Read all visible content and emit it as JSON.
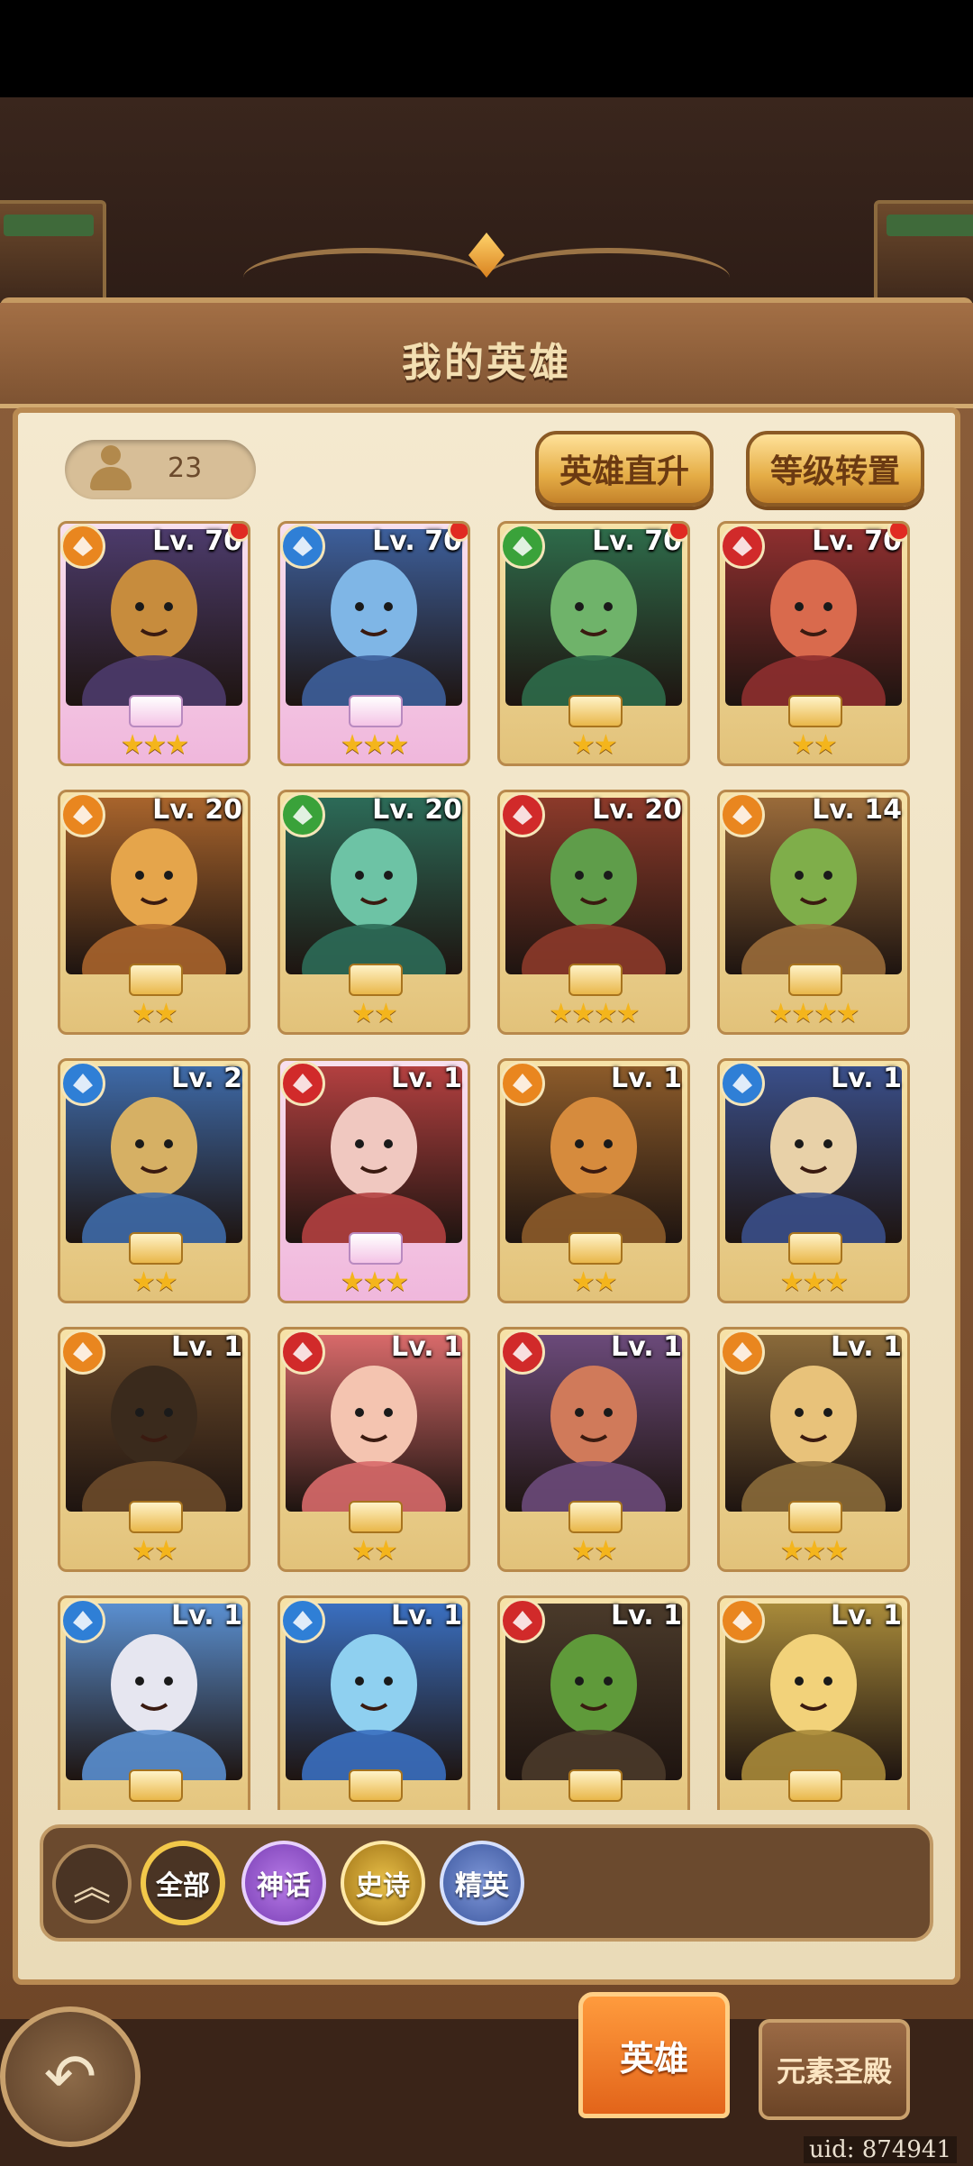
{
  "header": {
    "title": "我的英雄"
  },
  "hero_count": "23",
  "buttons": {
    "hero_boost": "英雄直升",
    "level_transfer": "等级转置"
  },
  "elements": {
    "fire": "#e9861f",
    "water": "#2f7fd6",
    "nature": "#3aa23a",
    "red": "#d12a2a"
  },
  "heroes": [
    {
      "level": "Lv. 70",
      "element": "fire",
      "stars": "★★★",
      "rarity": "mythic",
      "red_dot": true,
      "portrait": "dragonborn-warlock"
    },
    {
      "level": "Lv. 70",
      "element": "water",
      "stars": "★★★",
      "rarity": "mythic",
      "red_dot": true,
      "portrait": "blue-haired-fighter"
    },
    {
      "level": "Lv. 70",
      "element": "nature",
      "stars": "★★",
      "rarity": "epic",
      "red_dot": true,
      "portrait": "green-orc-druid"
    },
    {
      "level": "Lv. 70",
      "element": "red",
      "stars": "★★",
      "rarity": "epic",
      "red_dot": true,
      "portrait": "red-haired-bandit"
    },
    {
      "level": "Lv. 20",
      "element": "fire",
      "stars": "★★",
      "rarity": "epic",
      "red_dot": false,
      "portrait": "jester"
    },
    {
      "level": "Lv. 20",
      "element": "nature",
      "stars": "★★",
      "rarity": "epic",
      "red_dot": false,
      "portrait": "green-haired-elf"
    },
    {
      "level": "Lv. 20",
      "element": "red",
      "stars": "★★★★",
      "rarity": "elite",
      "red_dot": false,
      "portrait": "orc-pirate"
    },
    {
      "level": "Lv. 14",
      "element": "fire",
      "stars": "★★★★",
      "rarity": "elite",
      "red_dot": false,
      "portrait": "goblin-girl"
    },
    {
      "level": "Lv. 2",
      "element": "water",
      "stars": "★★",
      "rarity": "epic",
      "red_dot": false,
      "portrait": "masked-warrior"
    },
    {
      "level": "Lv. 1",
      "element": "red",
      "stars": "★★★",
      "rarity": "mythic",
      "red_dot": false,
      "portrait": "fox-spirit"
    },
    {
      "level": "Lv. 1",
      "element": "fire",
      "stars": "★★",
      "rarity": "epic",
      "red_dot": false,
      "portrait": "dwarf-monk"
    },
    {
      "level": "Lv. 1",
      "element": "water",
      "stars": "★★★",
      "rarity": "epic",
      "red_dot": false,
      "portrait": "goggle-girl"
    },
    {
      "level": "Lv. 1",
      "element": "fire",
      "stars": "★★",
      "rarity": "epic",
      "red_dot": false,
      "portrait": "dreadlock-hunter"
    },
    {
      "level": "Lv. 1",
      "element": "red",
      "stars": "★★",
      "rarity": "epic",
      "red_dot": false,
      "portrait": "pink-haired-elf"
    },
    {
      "level": "Lv. 1",
      "element": "red",
      "stars": "★★",
      "rarity": "epic",
      "red_dot": false,
      "portrait": "pilot-dwarf"
    },
    {
      "level": "Lv. 1",
      "element": "fire",
      "stars": "★★★",
      "rarity": "elite",
      "red_dot": false,
      "portrait": "bearded-paladin"
    },
    {
      "level": "Lv. 1",
      "element": "water",
      "stars": "",
      "rarity": "elite",
      "red_dot": false,
      "portrait": "old-mage"
    },
    {
      "level": "Lv. 1",
      "element": "water",
      "stars": "",
      "rarity": "elite",
      "red_dot": false,
      "portrait": "blue-elf-archer"
    },
    {
      "level": "Lv. 1",
      "element": "red",
      "stars": "",
      "rarity": "elite",
      "red_dot": false,
      "portrait": "orc-brute"
    },
    {
      "level": "Lv. 1",
      "element": "fire",
      "stars": "",
      "rarity": "elite",
      "red_dot": false,
      "portrait": "desert-assassin"
    }
  ],
  "filters": {
    "all": "全部",
    "mythic": "神话",
    "epic": "史诗",
    "elite": "精英"
  },
  "footer": {
    "tab_hero": "英雄",
    "tab_element_shrine": "元素圣殿",
    "uid": "uid: 874941"
  }
}
